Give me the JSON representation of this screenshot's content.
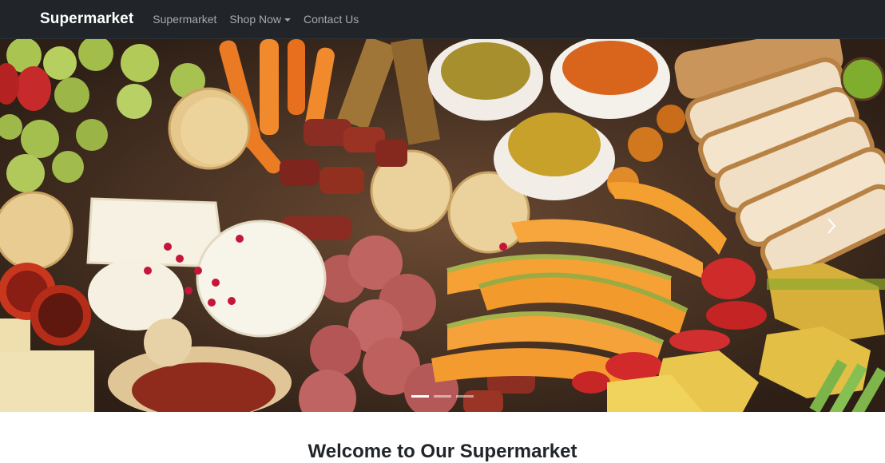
{
  "navbar": {
    "brand": "Supermarket",
    "links": [
      {
        "label": "Supermarket"
      },
      {
        "label": "Shop Now",
        "dropdown": true
      },
      {
        "label": "Contact Us"
      }
    ]
  },
  "carousel": {
    "slide_count": 3,
    "active_slide": 1,
    "next_icon": "chevron-right-icon",
    "image_subject": "charcuterie board with fruits, cheeses, crackers, salami and bread"
  },
  "main": {
    "heading": "Welcome to Our Supermarket"
  },
  "colors": {
    "navbar_bg": "#212529",
    "brand_text": "#ffffff",
    "nav_text": "rgba(255,255,255,0.6)",
    "heading_text": "#212529"
  }
}
